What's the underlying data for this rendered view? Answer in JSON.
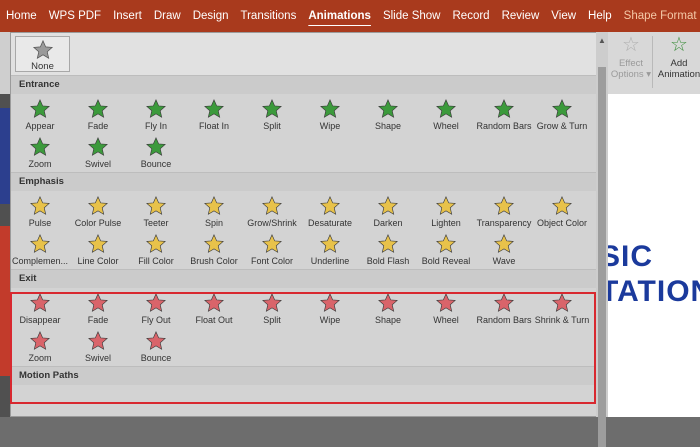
{
  "ribbon": {
    "tabs": [
      "Home",
      "WPS PDF",
      "Insert",
      "Draw",
      "Design",
      "Transitions",
      "Animations",
      "Slide Show",
      "Record",
      "Review",
      "View",
      "Help",
      "Shape Format"
    ],
    "active_tab": "Animations",
    "effect_options_line1": "Effect",
    "effect_options_line2": "Options",
    "add_animation_line1": "Add",
    "add_animation_line2": "Animation"
  },
  "gallery": {
    "none_label": "None",
    "sections": [
      {
        "title": "Entrance",
        "color": "#3c9a3c",
        "items": [
          "Appear",
          "Fade",
          "Fly In",
          "Float In",
          "Split",
          "Wipe",
          "Shape",
          "Wheel",
          "Random Bars",
          "Grow & Turn",
          "Zoom",
          "Swivel",
          "Bounce"
        ]
      },
      {
        "title": "Emphasis",
        "color": "#e8c24a",
        "items": [
          "Pulse",
          "Color Pulse",
          "Teeter",
          "Spin",
          "Grow/Shrink",
          "Desaturate",
          "Darken",
          "Lighten",
          "Transparency",
          "Object Color",
          "Complemen...",
          "Line Color",
          "Fill Color",
          "Brush Color",
          "Font Color",
          "Underline",
          "Bold Flash",
          "Bold Reveal",
          "Wave"
        ]
      },
      {
        "title": "Exit",
        "color": "#d9646a",
        "items": [
          "Disappear",
          "Fade",
          "Fly Out",
          "Float Out",
          "Split",
          "Wipe",
          "Shape",
          "Wheel",
          "Random Bars",
          "Shrink & Turn",
          "Zoom",
          "Swivel",
          "Bounce"
        ]
      },
      {
        "title": "Motion Paths",
        "color": "#888888",
        "items": []
      }
    ]
  },
  "slide": {
    "line1": "SIC",
    "line2": "TATION"
  }
}
